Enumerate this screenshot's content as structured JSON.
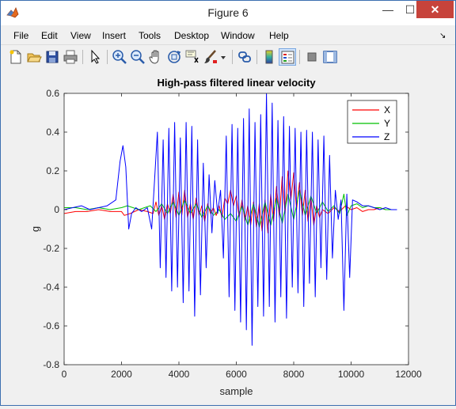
{
  "window": {
    "title": "Figure 6",
    "minimize_glyph": "—",
    "maximize_glyph": "☐",
    "close_glyph": "✕"
  },
  "menu": [
    {
      "label": "File"
    },
    {
      "label": "Edit"
    },
    {
      "label": "View"
    },
    {
      "label": "Insert"
    },
    {
      "label": "Tools"
    },
    {
      "label": "Desktop"
    },
    {
      "label": "Window"
    },
    {
      "label": "Help"
    }
  ],
  "menu_overflow_glyph": "↘",
  "toolbar": {
    "icons": [
      "new-figure-icon",
      "open-file-icon",
      "save-icon",
      "print-icon",
      "edit-plot-icon",
      "zoom-in-icon",
      "zoom-out-icon",
      "pan-icon",
      "rotate-3d-icon",
      "data-cursor-icon",
      "brush-icon",
      "brush-dropdown-icon",
      "link-plot-icon",
      "insert-colorbar-icon",
      "insert-legend-icon",
      "hide-plot-tools-icon",
      "show-plot-tools-icon"
    ],
    "active": "insert-legend-icon"
  },
  "colors": {
    "x_series": "#ff0000",
    "y_series": "#00c000",
    "z_series": "#0000ff",
    "close_button": "#c7433b"
  },
  "chart_data": {
    "type": "line",
    "title": "High-pass filtered linear velocity",
    "xlabel": "sample",
    "ylabel": "g",
    "xlim": [
      0,
      12000
    ],
    "ylim": [
      -0.8,
      0.6
    ],
    "xticks": [
      0,
      2000,
      4000,
      6000,
      8000,
      10000,
      12000
    ],
    "yticks": [
      -0.8,
      -0.6,
      -0.4,
      -0.2,
      0,
      0.2,
      0.4,
      0.6
    ],
    "grid": false,
    "legend_position": "top-right",
    "series": [
      {
        "name": "X",
        "color": "#ff0000",
        "x": [
          0,
          400,
          800,
          1200,
          1600,
          2000,
          2100,
          2300,
          2600,
          2900,
          3100,
          3200,
          3300,
          3400,
          3500,
          3600,
          3700,
          3800,
          3900,
          4000,
          4100,
          4200,
          4300,
          4400,
          4500,
          4600,
          4700,
          4800,
          4900,
          5000,
          5100,
          5200,
          5300,
          5400,
          5500,
          5600,
          5700,
          5800,
          5900,
          6000,
          6100,
          6200,
          6300,
          6400,
          6500,
          6600,
          6700,
          6800,
          6900,
          7000,
          7100,
          7200,
          7300,
          7400,
          7500,
          7600,
          7700,
          7800,
          7900,
          8000,
          8100,
          8200,
          8300,
          8400,
          8500,
          8600,
          8700,
          8800,
          8900,
          9000,
          9200,
          9400,
          9600,
          9800,
          10000,
          10200,
          10400,
          10600,
          10800,
          11000,
          11200,
          11400,
          11600
        ],
        "y": [
          -0.02,
          -0.01,
          -0.01,
          0.0,
          -0.01,
          -0.01,
          -0.03,
          -0.02,
          0.0,
          -0.01,
          -0.02,
          0.04,
          -0.03,
          0.02,
          -0.05,
          0.03,
          -0.02,
          0.08,
          -0.04,
          0.09,
          -0.03,
          0.1,
          -0.04,
          0.03,
          -0.05,
          0.06,
          -0.03,
          0.02,
          -0.06,
          0.03,
          -0.02,
          0.01,
          -0.03,
          0.02,
          -0.04,
          0.06,
          0.03,
          0.1,
          0.02,
          0.07,
          -0.04,
          0.05,
          -0.06,
          0.02,
          -0.08,
          0.04,
          -0.09,
          0.03,
          -0.11,
          0.05,
          -0.12,
          0.08,
          -0.06,
          0.12,
          -0.04,
          0.17,
          -0.02,
          0.2,
          0.05,
          0.19,
          0.0,
          0.14,
          -0.03,
          0.1,
          -0.06,
          0.06,
          -0.08,
          0.02,
          -0.04,
          0.0,
          -0.02,
          0.01,
          -0.01,
          0.02,
          0.0,
          0.01,
          -0.01,
          0.0,
          0.0,
          0.01,
          0.0,
          0.0,
          0.0
        ]
      },
      {
        "name": "Y",
        "color": "#00c000",
        "x": [
          0,
          400,
          800,
          1200,
          1600,
          2000,
          2200,
          2400,
          2600,
          2800,
          3000,
          3200,
          3400,
          3600,
          3800,
          4000,
          4200,
          4400,
          4600,
          4800,
          5000,
          5200,
          5400,
          5600,
          5800,
          6000,
          6200,
          6400,
          6600,
          6800,
          7000,
          7200,
          7400,
          7600,
          7800,
          8000,
          8200,
          8400,
          8600,
          8800,
          9000,
          9200,
          9400,
          9600,
          9750,
          9850,
          10000,
          10200,
          10400,
          10600,
          10800,
          11000,
          11200,
          11400,
          11600
        ],
        "y": [
          0.01,
          0.01,
          0.0,
          0.01,
          0.0,
          0.01,
          0.02,
          0.01,
          0.0,
          0.01,
          0.02,
          -0.01,
          0.03,
          -0.02,
          0.04,
          -0.03,
          0.05,
          -0.02,
          0.03,
          -0.04,
          0.02,
          -0.03,
          0.0,
          -0.05,
          -0.02,
          -0.06,
          0.02,
          -0.08,
          0.03,
          -0.09,
          0.04,
          -0.08,
          0.06,
          -0.07,
          0.08,
          -0.05,
          0.1,
          -0.03,
          0.07,
          -0.02,
          0.04,
          -0.01,
          0.02,
          -0.02,
          0.08,
          -0.03,
          0.02,
          0.03,
          0.01,
          0.02,
          0.01,
          0.01,
          0.0,
          0.0,
          0.0
        ]
      },
      {
        "name": "Z",
        "color": "#0000ff",
        "x": [
          0,
          300,
          600,
          900,
          1200,
          1500,
          1800,
          1950,
          2050,
          2150,
          2250,
          2350,
          2500,
          2700,
          2900,
          3050,
          3150,
          3250,
          3350,
          3450,
          3550,
          3650,
          3750,
          3850,
          3950,
          4050,
          4150,
          4250,
          4350,
          4450,
          4550,
          4650,
          4750,
          4850,
          4950,
          5050,
          5150,
          5250,
          5350,
          5450,
          5550,
          5650,
          5750,
          5850,
          5950,
          6050,
          6150,
          6250,
          6350,
          6450,
          6550,
          6650,
          6750,
          6850,
          6950,
          7050,
          7150,
          7250,
          7350,
          7450,
          7550,
          7650,
          7750,
          7850,
          7950,
          8050,
          8150,
          8250,
          8350,
          8450,
          8550,
          8650,
          8750,
          8850,
          8950,
          9050,
          9150,
          9250,
          9350,
          9450,
          9550,
          9650,
          9750,
          9850,
          9950,
          10050,
          10200,
          10400,
          10600,
          10800,
          11000,
          11200,
          11400,
          11600
        ],
        "y": [
          0.0,
          0.01,
          0.02,
          0.0,
          0.01,
          0.02,
          0.05,
          0.25,
          0.33,
          0.22,
          -0.1,
          -0.02,
          0.01,
          -0.01,
          0.01,
          -0.1,
          0.15,
          0.4,
          -0.3,
          0.36,
          -0.35,
          0.42,
          -0.42,
          0.45,
          -0.4,
          0.37,
          -0.48,
          0.45,
          -0.42,
          0.43,
          -0.55,
          0.36,
          -0.44,
          0.24,
          -0.3,
          0.18,
          -0.12,
          0.15,
          -0.02,
          0.1,
          -0.25,
          0.38,
          -0.45,
          0.44,
          -0.52,
          0.42,
          -0.58,
          0.47,
          -0.62,
          0.52,
          -0.7,
          0.45,
          -0.5,
          0.49,
          -0.55,
          0.6,
          -0.5,
          0.55,
          -0.58,
          0.46,
          -0.45,
          0.48,
          -0.56,
          0.43,
          -0.4,
          0.42,
          -0.43,
          0.4,
          -0.5,
          0.41,
          -0.38,
          0.4,
          -0.45,
          0.36,
          -0.3,
          0.38,
          -0.36,
          0.28,
          -0.25,
          0.1,
          -0.05,
          0.05,
          -0.52,
          0.08,
          -0.35,
          0.05,
          0.04,
          0.02,
          0.02,
          0.01,
          0.0,
          0.01,
          0.0,
          0.0
        ]
      }
    ]
  }
}
